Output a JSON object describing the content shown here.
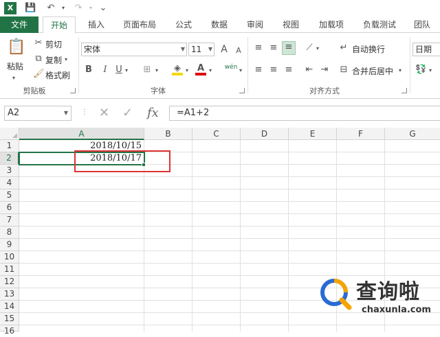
{
  "qat": {
    "excel_logo": "X",
    "save": "💾",
    "undo": "↶",
    "redo": "↷",
    "more": "⌄"
  },
  "tabs": [
    "文件",
    "开始",
    "插入",
    "页面布局",
    "公式",
    "数据",
    "审阅",
    "视图",
    "加载项",
    "负载测试",
    "团队"
  ],
  "ribbon": {
    "clipboard": {
      "paste": "粘贴",
      "cut": "剪切",
      "copy": "复制",
      "format_painter": "格式刷",
      "group": "剪贴板"
    },
    "font": {
      "name": "宋体",
      "size": "11",
      "group": "字体",
      "bold": "B",
      "italic": "I",
      "underline": "U",
      "grow": "A",
      "shrink": "A",
      "phonetic": "wén"
    },
    "alignment": {
      "wrap": "自动换行",
      "merge": "合并后居中",
      "group": "对齐方式"
    },
    "number": {
      "format": "日期"
    }
  },
  "formula_bar": {
    "name_box": "A2",
    "cancel": "✕",
    "enter": "✓",
    "fx": "fx",
    "formula": "=A1+2"
  },
  "columns": [
    "A",
    "B",
    "C",
    "D",
    "E",
    "F",
    "G"
  ],
  "rows": [
    "1",
    "2",
    "3",
    "4",
    "5",
    "6",
    "7",
    "8",
    "9",
    "10",
    "11",
    "12",
    "13",
    "14",
    "15",
    "16"
  ],
  "cells": {
    "A1": "2018/10/15",
    "A2": "2018/10/17"
  },
  "watermark": {
    "brand": "查询啦",
    "url": "chaxunla.com"
  },
  "colors": {
    "accent": "#217346",
    "highlight": "#d33333"
  }
}
